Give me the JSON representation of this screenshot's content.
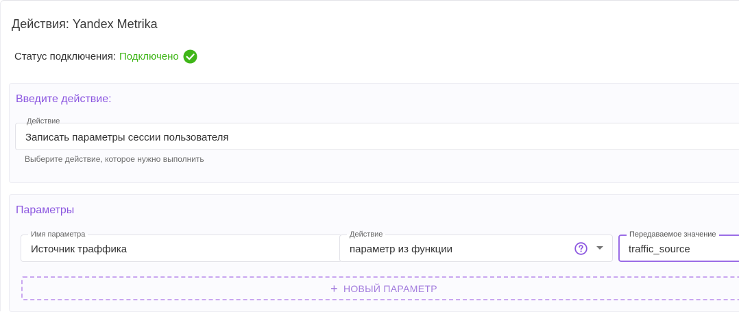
{
  "header": {
    "title": "Действия: Yandex Metrika"
  },
  "status": {
    "label": "Статус подключения:",
    "value": "Подключено",
    "check_icon": "check-circle-icon",
    "color": "#3fb618"
  },
  "action_section": {
    "title": "Введите действие:",
    "field_label": "Действие",
    "field_value": "Записать параметры сессии пользователя",
    "helper": "Выберите действие, которое нужно выполнить"
  },
  "params_section": {
    "title": "Параметры",
    "param_name": {
      "label": "Имя параметра",
      "value": "Источник траффика"
    },
    "param_action": {
      "label": "Действие",
      "value": "параметр из функции",
      "help_icon": "question-circle-icon",
      "dropdown_icon": "chevron-down-icon"
    },
    "param_value": {
      "label": "Передаваемое значение",
      "value": "traffic_source"
    },
    "add_button": {
      "label": "НОВЫЙ ПАРАМЕТР",
      "icon": "plus-icon"
    }
  },
  "colors": {
    "accent": "#8c57e0",
    "success": "#3fb618",
    "dashed_border": "#c9a6f0"
  }
}
